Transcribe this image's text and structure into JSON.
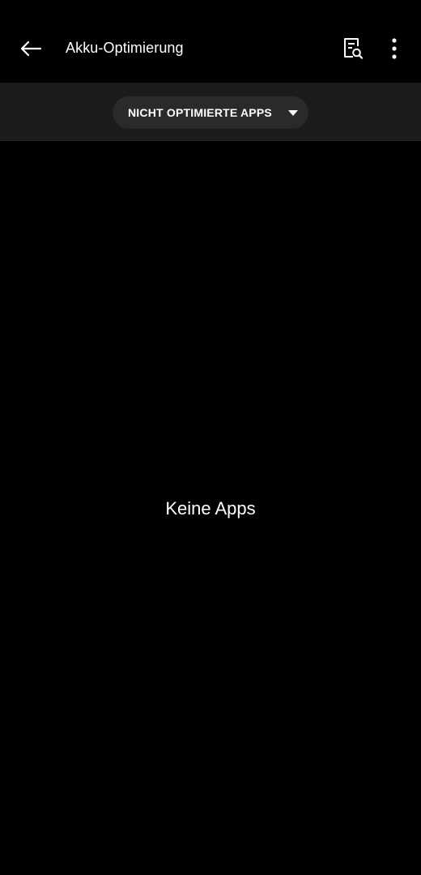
{
  "app_bar": {
    "title": "Akku-Optimierung",
    "back_icon": "arrow-back-icon",
    "search_icon": "document-search-icon",
    "more_icon": "more-vert-icon"
  },
  "filter": {
    "selected": "NICHT OPTIMIERTE APPS",
    "dropdown_icon": "arrow-drop-down-icon"
  },
  "content": {
    "empty_message": "Keine Apps"
  },
  "colors": {
    "background": "#000000",
    "filter_bar": "#1b1b1b",
    "pill": "#2a2a2a",
    "text": "#ffffff"
  }
}
